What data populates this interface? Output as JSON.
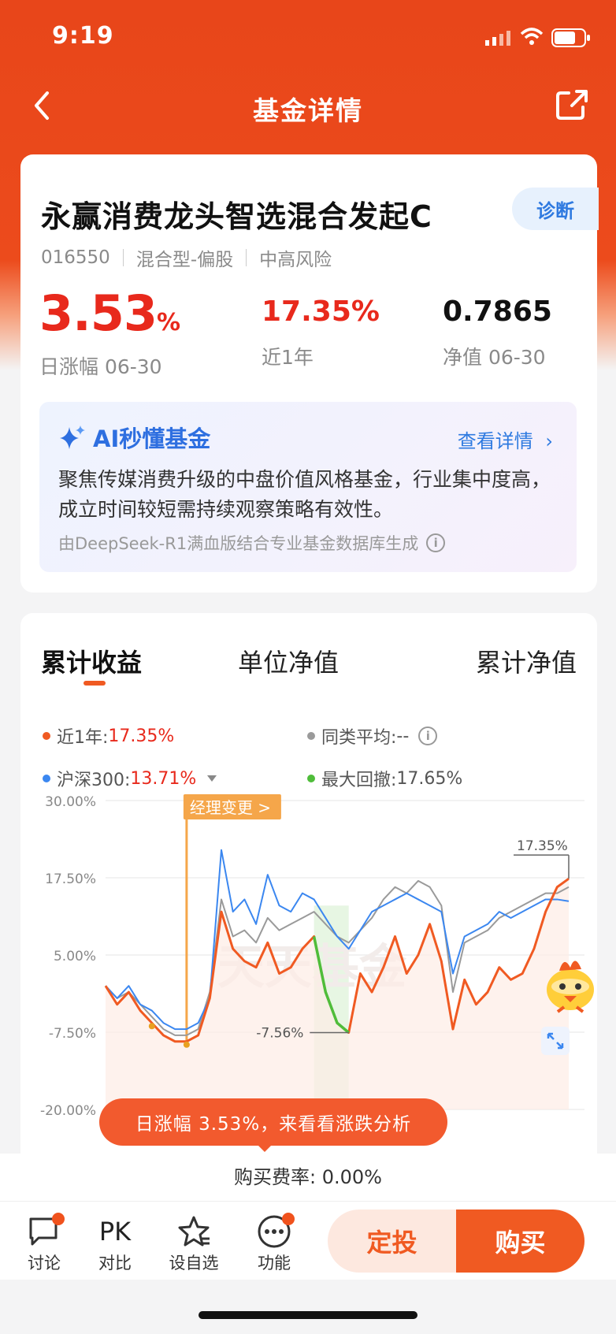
{
  "status": {
    "time": "9:19"
  },
  "header": {
    "title": "基金详情"
  },
  "fund": {
    "name": "永赢消费龙头智选混合发起C",
    "diagnose_label": "诊断",
    "code": "016550",
    "type": "混合型-偏股",
    "risk": "中高风险"
  },
  "stats": {
    "daily_value": "3.53",
    "daily_unit": "%",
    "daily_label": "日涨幅 06-30",
    "year_value": "17.35%",
    "year_label": "近1年",
    "nav_value": "0.7865",
    "nav_label": "净值 06-30"
  },
  "ai": {
    "title": "AI秒懂基金",
    "more": "查看详情",
    "text": "聚焦传媒消费升级的中盘价值风格基金，行业集中度高，成立时间较短需持续观察策略有效性。",
    "footnote": "由DeepSeek-R1满血版结合专业基金数据库生成"
  },
  "tabs": [
    "累计收益",
    "单位净值",
    "累计净值"
  ],
  "legend": {
    "fund_label": "近1年: ",
    "fund_value": "17.35%",
    "peer_label": "同类平均: ",
    "peer_value": "--",
    "index_label": "沪深300: ",
    "index_value": "13.71%",
    "drawdown_label": "最大回撤: ",
    "drawdown_value": "17.65%"
  },
  "chart_labels": {
    "y_ticks": [
      "30.00%",
      "17.50%",
      "5.00%",
      "-7.50%",
      "-20.00%"
    ],
    "manager_change": "经理变更 >",
    "end_label": "17.35%",
    "min_label": "-7.56%",
    "watermark": "天天基金"
  },
  "chart_data": {
    "type": "line",
    "ylim": [
      -20,
      30
    ],
    "y_ticks": [
      30,
      17.5,
      5,
      -7.5,
      -20
    ],
    "x": [
      0,
      1,
      2,
      3,
      4,
      5,
      6,
      7,
      8,
      9,
      10,
      11,
      12,
      13,
      14,
      15,
      16,
      17,
      18,
      19,
      20,
      21,
      22,
      23,
      24,
      25,
      26,
      27,
      28,
      29,
      30,
      31,
      32,
      33,
      34,
      35,
      36,
      37,
      38,
      39,
      40
    ],
    "series": [
      {
        "name": "近1年",
        "color": "#f05a22",
        "values": [
          0,
          -3,
          -1,
          -4,
          -6,
          -8,
          -9,
          -9,
          -8,
          -2,
          12,
          6,
          4,
          3,
          7,
          2,
          3,
          6,
          8,
          -1,
          -6,
          -7.56,
          2,
          -1,
          3,
          8,
          2,
          5,
          10,
          4,
          -7,
          1,
          -3,
          -1,
          3,
          1,
          2,
          6,
          12,
          16,
          17.35
        ]
      },
      {
        "name": "沪深300",
        "color": "#3b87f0",
        "values": [
          0,
          -2,
          0,
          -3,
          -4,
          -6,
          -7,
          -7,
          -6,
          -2,
          22,
          12,
          14,
          10,
          18,
          13,
          12,
          15,
          14,
          11,
          8,
          6,
          9,
          12,
          13,
          14,
          15,
          14,
          13,
          12,
          2,
          8,
          9,
          10,
          12,
          11,
          12,
          13,
          14,
          14,
          13.71
        ]
      },
      {
        "name": "同类平均",
        "color": "#9a9a9a",
        "values": [
          0,
          -2,
          -1,
          -3,
          -5,
          -7,
          -8,
          -8,
          -7,
          -1,
          14,
          8,
          9,
          7,
          11,
          9,
          10,
          11,
          12,
          10,
          8,
          7,
          9,
          11,
          14,
          16,
          15,
          17,
          16,
          13,
          -1,
          7,
          8,
          9,
          11,
          12,
          13,
          14,
          15,
          15,
          16
        ]
      }
    ],
    "max_drawdown_value": -7.56
  },
  "bubble": {
    "text": "日涨幅 3.53%，来看看涨跌分析"
  },
  "fee": {
    "text": "购买费率: 0.00%"
  },
  "bottom": {
    "discuss": "讨论",
    "pk_icon": "PK",
    "compare": "对比",
    "watchlist": "设自选",
    "function": "功能",
    "invest": "定投",
    "buy": "购买"
  },
  "colors": {
    "brand": "#ec4b1c",
    "up": "#e8291c",
    "accent": "#f05a22",
    "index": "#3b87f0",
    "peer": "#9a9a9a",
    "drawdown": "#4fbd3a"
  }
}
